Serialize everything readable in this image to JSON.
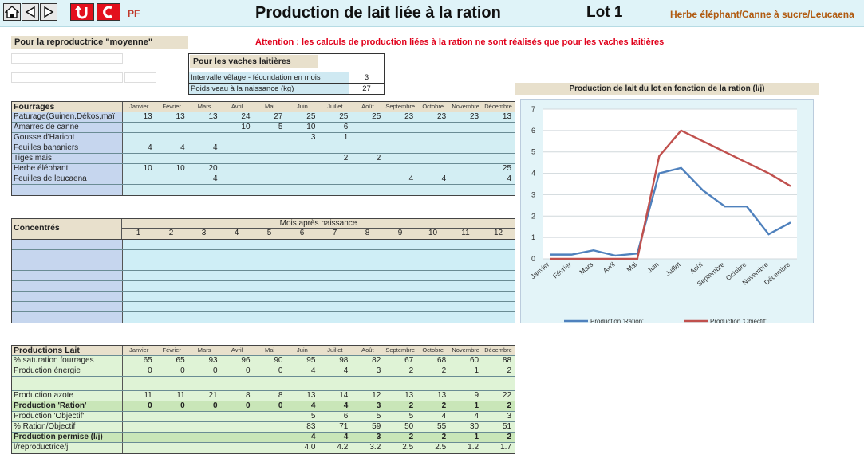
{
  "header": {
    "pf_label": "PF",
    "title": "Production de lait liée à la ration",
    "lot": "Lot 1",
    "ration_name": "Herbe éléphant/Canne à sucre/Leucaena"
  },
  "reproductrice_label": "Pour la reproductrice \"moyenne\"",
  "warning": "Attention : les calculs de production liées à la ration ne sont réalisés que pour les vaches laitières",
  "params": {
    "title": "Pour les vaches laitières",
    "rows": [
      {
        "label": "Intervalle vêlage - fécondation en mois",
        "value": "3"
      },
      {
        "label": "Poids veau à la naissance (kg)",
        "value": "27"
      }
    ]
  },
  "months": [
    "Janvier",
    "Février",
    "Mars",
    "Avril",
    "Mai",
    "Juin",
    "Juillet",
    "Août",
    "Septembre",
    "Octobre",
    "Novembre",
    "Décembre"
  ],
  "fourrages": {
    "title": "Fourrages",
    "rows": [
      {
        "label": "Paturage(Guinen,Dékos,maï",
        "values": [
          "13",
          "13",
          "13",
          "24",
          "27",
          "25",
          "25",
          "25",
          "23",
          "23",
          "23",
          "13"
        ]
      },
      {
        "label": "Amarres de canne",
        "values": [
          "",
          "",
          "",
          "10",
          "5",
          "10",
          "6",
          "",
          "",
          "",
          "",
          ""
        ]
      },
      {
        "label": "Gousse d'Haricot",
        "values": [
          "",
          "",
          "",
          "",
          "",
          "3",
          "1",
          "",
          "",
          "",
          "",
          ""
        ]
      },
      {
        "label": "Feuilles bananiers",
        "values": [
          "4",
          "4",
          "4",
          "",
          "",
          "",
          "",
          "",
          "",
          "",
          "",
          ""
        ]
      },
      {
        "label": "Tiges mais",
        "values": [
          "",
          "",
          "",
          "",
          "",
          "",
          "2",
          "2",
          "",
          "",
          "",
          ""
        ]
      },
      {
        "label": "Herbe éléphant",
        "values": [
          "10",
          "10",
          "20",
          "",
          "",
          "",
          "",
          "",
          "",
          "",
          "",
          "25"
        ]
      },
      {
        "label": "Feuilles de leucaena",
        "values": [
          "",
          "",
          "4",
          "",
          "",
          "",
          "",
          "",
          "4",
          "4",
          "",
          "4"
        ]
      },
      {
        "label": "",
        "values": [
          "",
          "",
          "",
          "",
          "",
          "",
          "",
          "",
          "",
          "",
          "",
          ""
        ]
      }
    ]
  },
  "concentres": {
    "title": "Concentrés",
    "subtitle": "Mois après naissance",
    "cols": [
      "1",
      "2",
      "3",
      "4",
      "5",
      "6",
      "7",
      "8",
      "9",
      "10",
      "11",
      "12"
    ],
    "empty_rows": 8
  },
  "productions": {
    "title": "Productions Lait",
    "rows": [
      {
        "label": "% saturation fourrages",
        "values": [
          "65",
          "65",
          "93",
          "96",
          "90",
          "95",
          "98",
          "82",
          "67",
          "68",
          "60",
          "88"
        ],
        "style": ""
      },
      {
        "label": "Production énergie",
        "values": [
          "0",
          "0",
          "0",
          "0",
          "0",
          "4",
          "4",
          "3",
          "2",
          "2",
          "1",
          "2"
        ],
        "style": ""
      },
      {
        "label": "",
        "values": [
          "",
          "",
          "",
          "",
          "",
          "",
          "",
          "",
          "",
          "",
          "",
          ""
        ],
        "style": "gap"
      },
      {
        "label": "Production azote",
        "values": [
          "11",
          "11",
          "21",
          "8",
          "8",
          "13",
          "14",
          "12",
          "13",
          "13",
          "9",
          "22"
        ],
        "style": ""
      },
      {
        "label": "Production 'Ration'",
        "values": [
          "0",
          "0",
          "0",
          "0",
          "0",
          "4",
          "4",
          "3",
          "2",
          "2",
          "1",
          "2"
        ],
        "style": "bold"
      },
      {
        "label": "Production 'Objectif'",
        "values": [
          "",
          "",
          "",
          "",
          "",
          "5",
          "6",
          "5",
          "5",
          "4",
          "4",
          "3"
        ],
        "style": ""
      },
      {
        "label": "% Ration/Objectif",
        "values": [
          "",
          "",
          "",
          "",
          "",
          "83",
          "71",
          "59",
          "50",
          "55",
          "30",
          "51"
        ],
        "style": ""
      },
      {
        "label": "Production permise (l/j)",
        "values": [
          "",
          "",
          "",
          "",
          "",
          "4",
          "4",
          "3",
          "2",
          "2",
          "1",
          "2"
        ],
        "style": "bold"
      },
      {
        "label": "l/reproductrice/j",
        "values": [
          "",
          "",
          "",
          "",
          "",
          "4.0",
          "4.2",
          "3.2",
          "2.5",
          "2.5",
          "1.2",
          "1.7"
        ],
        "style": ""
      }
    ]
  },
  "chart_data": {
    "type": "line",
    "title": "Production de lait du lot en fonction de la ration (l/j)",
    "categories": [
      "Janvier",
      "Février",
      "Mars",
      "Avril",
      "Mai",
      "Juin",
      "Juillet",
      "Août",
      "Septembre",
      "Octobre",
      "Novembre",
      "Décembre"
    ],
    "ylim": [
      0,
      7
    ],
    "yticks": [
      0,
      1,
      2,
      3,
      4,
      5,
      6,
      7
    ],
    "grid": true,
    "legend": "bottom",
    "series": [
      {
        "name": "Production 'Ration'",
        "color": "#4f81bd",
        "values": [
          0.2,
          0.2,
          0.4,
          0.15,
          0.25,
          4.0,
          4.25,
          3.2,
          2.45,
          2.45,
          1.15,
          1.7
        ]
      },
      {
        "name": "Production 'Objectif'",
        "color": "#c0504d",
        "values": [
          0,
          0,
          0,
          0,
          0,
          4.8,
          6.0,
          5.5,
          5.0,
          4.5,
          4.0,
          3.4
        ]
      }
    ]
  }
}
